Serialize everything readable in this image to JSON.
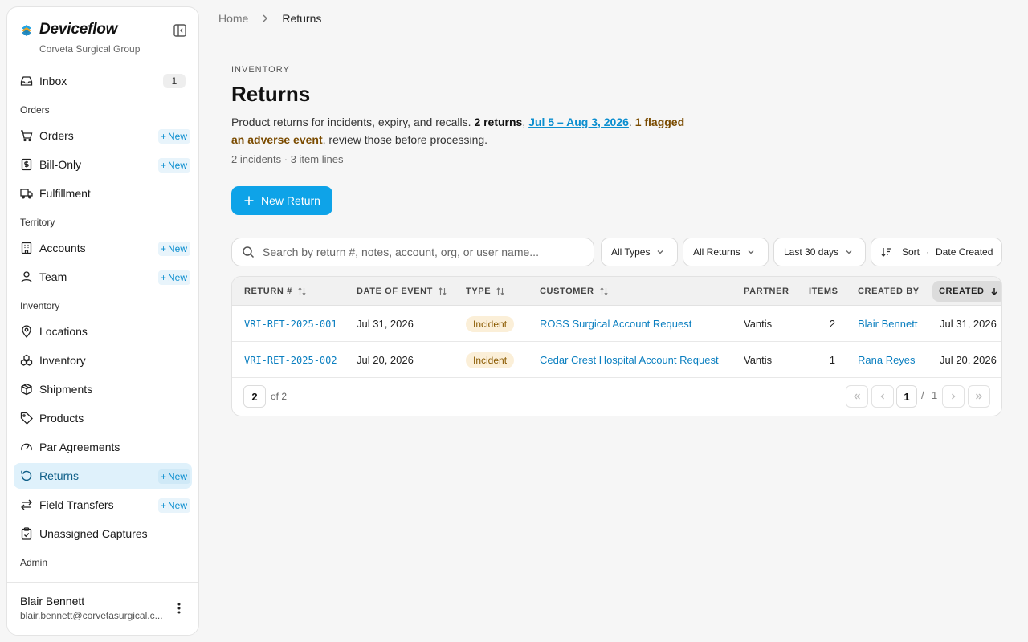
{
  "sidebar": {
    "brand": "Deviceflow",
    "org": "Corveta Surgical Group",
    "inbox": {
      "label": "Inbox",
      "badge": "1"
    },
    "sections": {
      "orders": "Orders",
      "territory": "Territory",
      "inventory": "Inventory",
      "admin": "Admin"
    },
    "new_label": "New",
    "items": {
      "orders": "Orders",
      "bill_only": "Bill-Only",
      "fulfillment": "Fulfillment",
      "accounts": "Accounts",
      "team": "Team",
      "locations": "Locations",
      "inventory": "Inventory",
      "shipments": "Shipments",
      "products": "Products",
      "par_agreements": "Par Agreements",
      "returns": "Returns",
      "field_transfers": "Field Transfers",
      "unassigned_captures": "Unassigned Captures"
    },
    "user": {
      "name": "Blair Bennett",
      "email": "blair.bennett@corvetasurgical.c..."
    }
  },
  "breadcrumb": {
    "home": "Home",
    "current": "Returns"
  },
  "header": {
    "eyebrow": "INVENTORY",
    "title": "Returns",
    "desc_1": "Product returns for incidents, expiry, and recalls. ",
    "desc_count": "2 returns",
    "desc_comma": ", ",
    "desc_range": "Jul 5 – Aug 3, 2026",
    "desc_dot": ". ",
    "desc_flag": "1 flagged an adverse event",
    "desc_2": ", review those before processing.",
    "meta": "2 incidents · 3 item lines"
  },
  "new_return_label": "New Return",
  "search": {
    "placeholder": "Search by return #, notes, account, org, or user name..."
  },
  "filters": {
    "types": "All Types",
    "returns": "All Returns",
    "range": "Last 30 days"
  },
  "sort": {
    "label": "Sort",
    "sep": "·",
    "value": "Date Created"
  },
  "table": {
    "columns": {
      "return_no": "RETURN #",
      "date_of_event": "DATE OF EVENT",
      "type": "TYPE",
      "customer": "CUSTOMER",
      "partner": "PARTNER",
      "items": "ITEMS",
      "created_by": "CREATED BY",
      "created": "CREATED"
    },
    "rows": [
      {
        "return_no": "VRI-RET-2025-001",
        "date": "Jul 31, 2026",
        "type": "Incident",
        "customer": "ROSS Surgical Account Request",
        "partner": "Vantis",
        "items": "2",
        "created_by": "Blair Bennett",
        "created": "Jul 31, 2026"
      },
      {
        "return_no": "VRI-RET-2025-002",
        "date": "Jul 20, 2026",
        "type": "Incident",
        "customer": "Cedar Crest Hospital Account Request",
        "partner": "Vantis",
        "items": "1",
        "created_by": "Rana Reyes",
        "created": "Jul 20, 2026"
      }
    ]
  },
  "pagination": {
    "page_size": "2",
    "of_label": "of 2",
    "current": "1",
    "slash": "/",
    "total": "1"
  },
  "colors": {
    "accent": "#0ea3e8",
    "link": "#0b7fc0",
    "active_nav": "#dff1fb",
    "incident_pill": "#fbefd8"
  }
}
